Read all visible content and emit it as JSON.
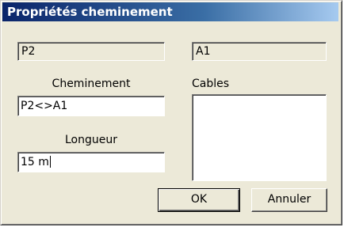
{
  "window": {
    "title": "Propriétés cheminement"
  },
  "fields": {
    "origin": "P2",
    "destination": "A1",
    "route_label": "Cheminement",
    "route_value": "P2<>A1",
    "length_label": "Longueur",
    "length_value": "15 m",
    "cables_label": "Cables"
  },
  "buttons": {
    "ok": "OK",
    "cancel": "Annuler"
  }
}
